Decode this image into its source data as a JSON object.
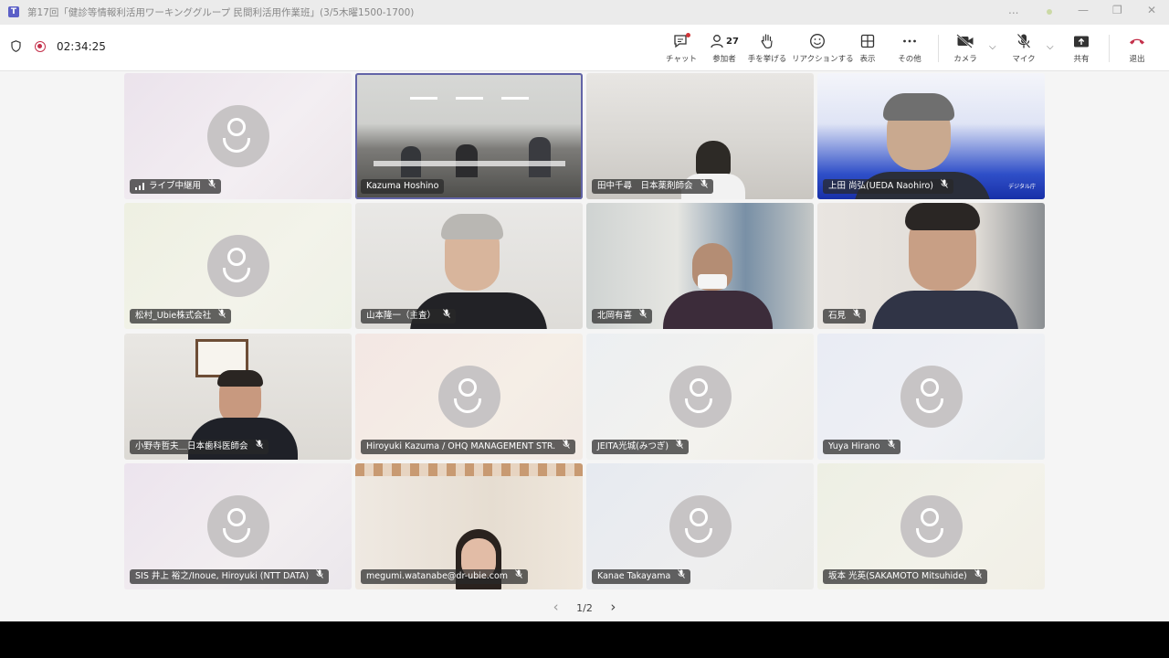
{
  "window": {
    "title": "第17回「健診等情報利活用ワーキンググループ 民間利活用作業班」(3/5木曜1500-1700)",
    "controls": [
      "...",
      "—",
      "❐",
      "✕"
    ]
  },
  "call": {
    "timer": "02:34:25"
  },
  "toolbar": {
    "chat_label": "チャット",
    "participants_label": "参加者",
    "participants_count": "27",
    "raise_hand_label": "手を挙げる",
    "reactions_label": "リアクションする",
    "view_label": "表示",
    "more_label": "その他",
    "camera_label": "カメラ",
    "mic_label": "マイク",
    "share_label": "共有",
    "leave_label": "退出"
  },
  "tiles": [
    {
      "name": "ライブ中継用",
      "signal": true
    },
    {
      "name": "Kazuma Hoshino"
    },
    {
      "name": "田中千尋　日本薬剤師会"
    },
    {
      "name": "上田 尚弘(UEDA Naohiro)",
      "bg_text": "デジタル庁"
    },
    {
      "name": "松村_Ubie株式会社"
    },
    {
      "name": "山本隆一（主査）"
    },
    {
      "name": "北岡有喜"
    },
    {
      "name": "石見"
    },
    {
      "name": "小野寺哲夫＿日本歯科医師会"
    },
    {
      "name": "Hiroyuki Kazuma / OHQ MANAGEMENT STR."
    },
    {
      "name": "JEITA光城(みつぎ)"
    },
    {
      "name": "Yuya Hirano"
    },
    {
      "name": "SIS 井上 裕之/Inoue, Hiroyuki (NTT DATA)"
    },
    {
      "name": "megumi.watanabe@dr-ubie.com"
    },
    {
      "name": "Kanae Takayama"
    },
    {
      "name": "坂本 光英(SAKAMOTO Mitsuhide)"
    }
  ],
  "pager": {
    "label": "1/2",
    "prev": "‹",
    "next": "›"
  }
}
